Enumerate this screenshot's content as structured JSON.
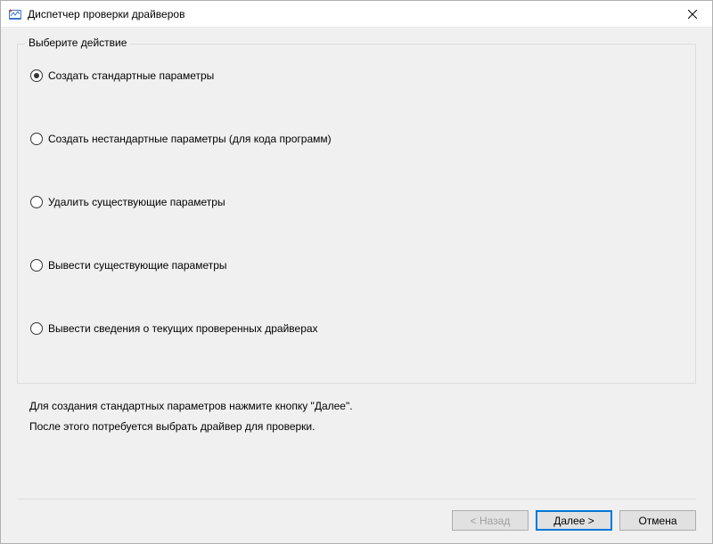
{
  "window": {
    "title": "Диспетчер проверки драйверов"
  },
  "groupbox": {
    "label": "Выберите действие",
    "options": [
      {
        "label": "Создать стандартные параметры",
        "checked": true
      },
      {
        "label": "Создать нестандартные параметры (для кода программ)",
        "checked": false
      },
      {
        "label": "Удалить существующие параметры",
        "checked": false
      },
      {
        "label": "Вывести существующие параметры",
        "checked": false
      },
      {
        "label": "Вывести сведения о текущих проверенных драйверах",
        "checked": false
      }
    ]
  },
  "description": {
    "line1": "Для создания стандартных параметров нажмите кнопку \"Далее\".",
    "line2": "После этого потребуется выбрать драйвер для проверки."
  },
  "buttons": {
    "back": "< Назад",
    "next": "Далее >",
    "cancel": "Отмена"
  }
}
